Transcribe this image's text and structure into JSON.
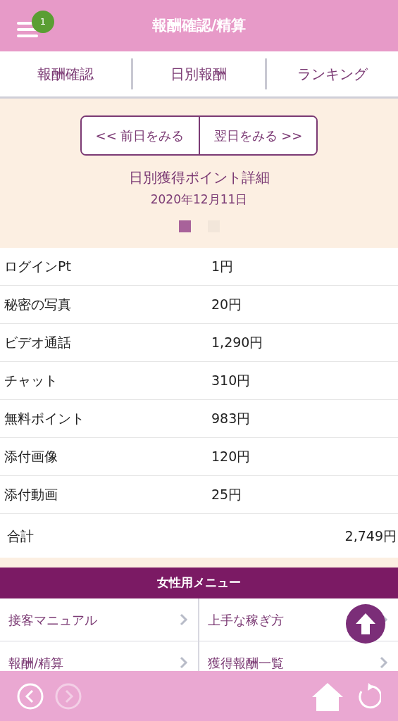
{
  "header": {
    "title": "報酬確認/精算",
    "badge": "1"
  },
  "tabs": [
    {
      "label": "報酬確認"
    },
    {
      "label": "日別報酬"
    },
    {
      "label": "ランキング"
    }
  ],
  "pager": {
    "prev": "<< 前日をみる",
    "next": "翌日をみる >>"
  },
  "detail": {
    "title": "日別獲得ポイント詳細",
    "date": "2020年12月11日",
    "dots": [
      {
        "selected": true
      },
      {
        "selected": false
      }
    ]
  },
  "rows": [
    {
      "label": "ログインPt",
      "value": "1円"
    },
    {
      "label": "秘密の写真",
      "value": "20円"
    },
    {
      "label": "ビデオ通話",
      "value": "1,290円"
    },
    {
      "label": "チャット",
      "value": "310円"
    },
    {
      "label": "無料ポイント",
      "value": "983円"
    },
    {
      "label": "添付画像",
      "value": "120円"
    },
    {
      "label": "添付動画",
      "value": "25円"
    }
  ],
  "total": {
    "label": "合計",
    "value": "2,749円"
  },
  "menu": {
    "title": "女性用メニュー",
    "items": [
      {
        "label": "接客マニュアル"
      },
      {
        "label": "上手な稼ぎ方"
      },
      {
        "label": "報酬/精算"
      },
      {
        "label": "獲得報酬一覧"
      }
    ]
  },
  "footer": {
    "back_disabled": false,
    "forward_disabled": true
  }
}
